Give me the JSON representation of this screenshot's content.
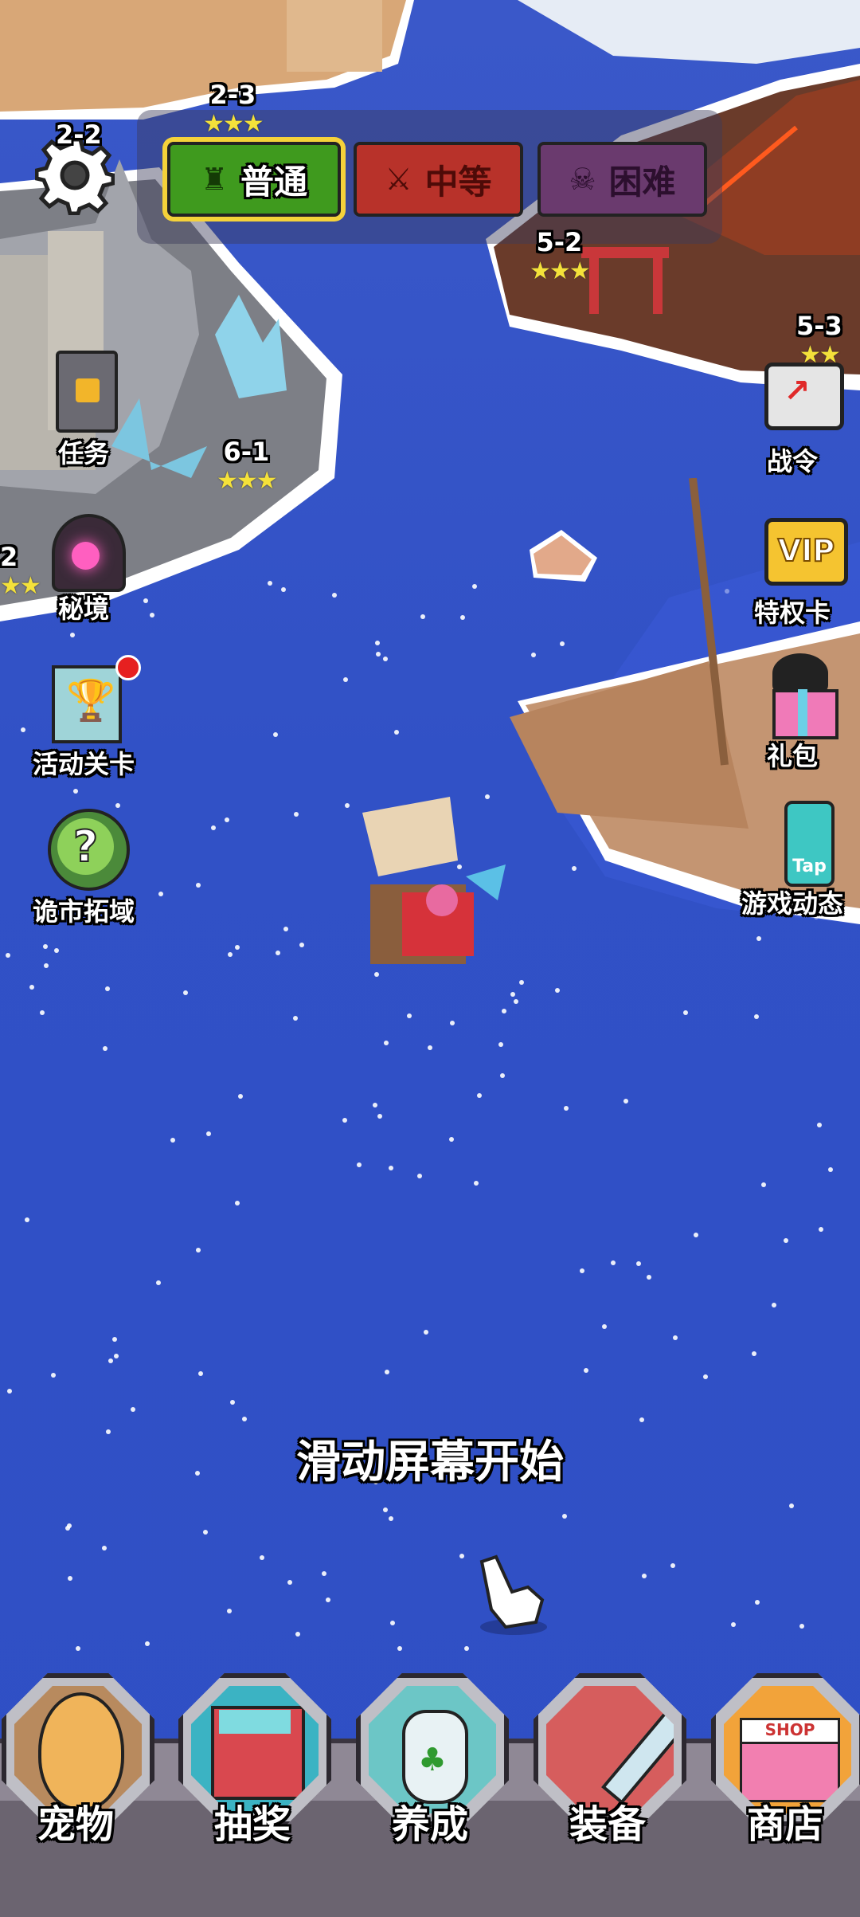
{
  "difficulty": {
    "normal": "普通",
    "medium": "中等",
    "hard": "困难"
  },
  "levels": {
    "l2_3": "2-3",
    "l2_2": "2-2",
    "l6_1": "6-1",
    "l5_2": "5-2",
    "l5_3": "5-3",
    "l2": "2"
  },
  "left_menu": {
    "task": "任务",
    "secret": "秘境",
    "event": "活动关卡",
    "weird": "诡市拓域"
  },
  "right_menu": {
    "battlepass": "战令",
    "vip": "特权卡",
    "vip_badge": "VIP",
    "gift": "礼包",
    "news": "游戏动态",
    "tap_badge": "Tap"
  },
  "hint": "滑动屏幕开始",
  "nav": {
    "pet": "宠物",
    "lottery": "抽奖",
    "nurture": "养成",
    "equip": "装备",
    "shop": "商店",
    "shop_sign": "SHOP"
  },
  "colors": {
    "normal": "#3f9a1e",
    "medium": "#b8322a",
    "hard": "#6a3a6e",
    "sea": "#3452c8"
  }
}
